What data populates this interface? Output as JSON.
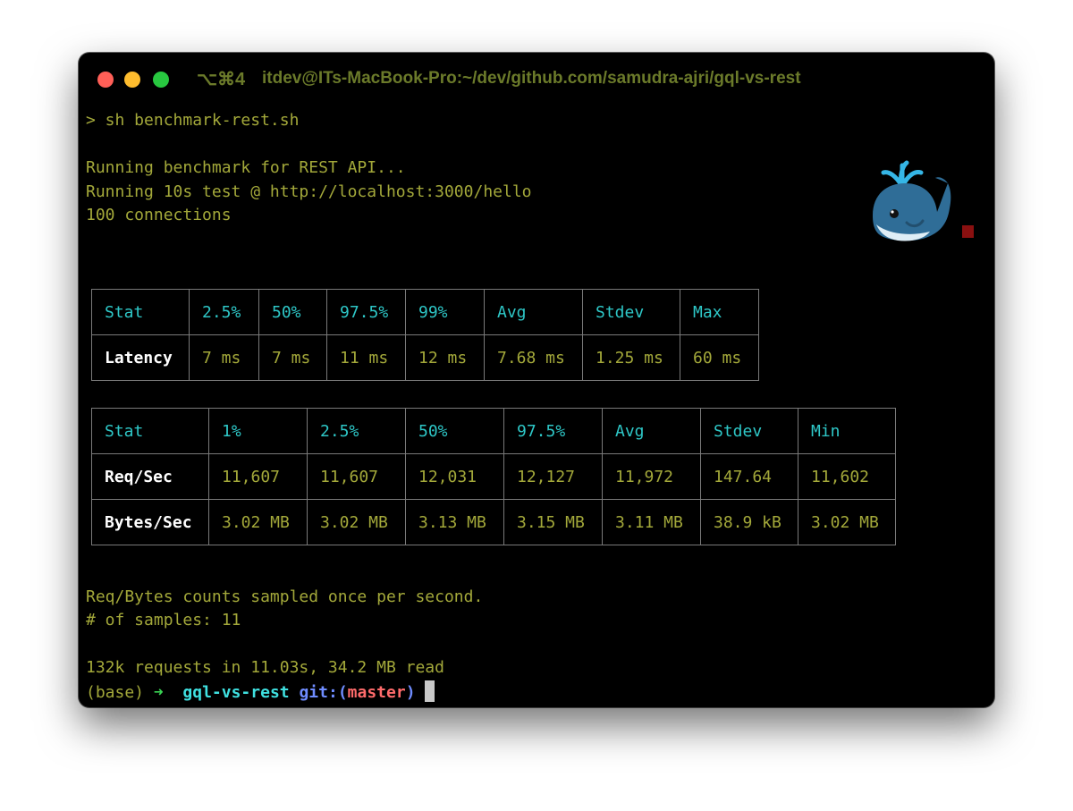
{
  "window": {
    "tab_shortcut": "⌥⌘4",
    "title": "itdev@ITs-MacBook-Pro:~/dev/github.com/samudra-ajri/gql-vs-rest"
  },
  "terminal": {
    "command": "> sh benchmark-rest.sh",
    "lines": [
      "Running benchmark for REST API...",
      "Running 10s test @ http://localhost:3000/hello",
      "100 connections"
    ],
    "footer": [
      "Req/Bytes counts sampled once per second.",
      "# of samples: 11",
      "132k requests in 11.03s, 34.2 MB read"
    ]
  },
  "latency_table": {
    "headers": [
      "Stat",
      "2.5%",
      "50%",
      "97.5%",
      "99%",
      "Avg",
      "Stdev",
      "Max"
    ],
    "rows": [
      [
        "Latency",
        "7 ms",
        "7 ms",
        "11 ms",
        "12 ms",
        "7.68 ms",
        "1.25 ms",
        "60 ms"
      ]
    ]
  },
  "throughput_table": {
    "headers": [
      "Stat",
      "1%",
      "2.5%",
      "50%",
      "97.5%",
      "Avg",
      "Stdev",
      "Min"
    ],
    "rows": [
      [
        "Req/Sec",
        "11,607",
        "11,607",
        "12,031",
        "12,127",
        "11,972",
        "147.64",
        "11,602"
      ],
      [
        "Bytes/Sec",
        "3.02 MB",
        "3.02 MB",
        "3.13 MB",
        "3.15 MB",
        "3.11 MB",
        "38.9 kB",
        "3.02 MB"
      ]
    ]
  },
  "prompt": {
    "env": "(base)",
    "arrow": "➜",
    "dir": "gql-vs-rest",
    "git_label": "git:(",
    "branch": "master",
    "git_close": ")"
  },
  "icons": {
    "whale": "spouting-whale-icon",
    "indicator": "red-square-indicator"
  },
  "colors": {
    "text": "#a3a83a",
    "header": "#2ec7c7",
    "row_label": "#ffffff",
    "title": "#6b7a2a",
    "prompt_dir": "#3fe0e0",
    "prompt_git": "#6f8cff",
    "prompt_branch": "#ff6b6b"
  }
}
